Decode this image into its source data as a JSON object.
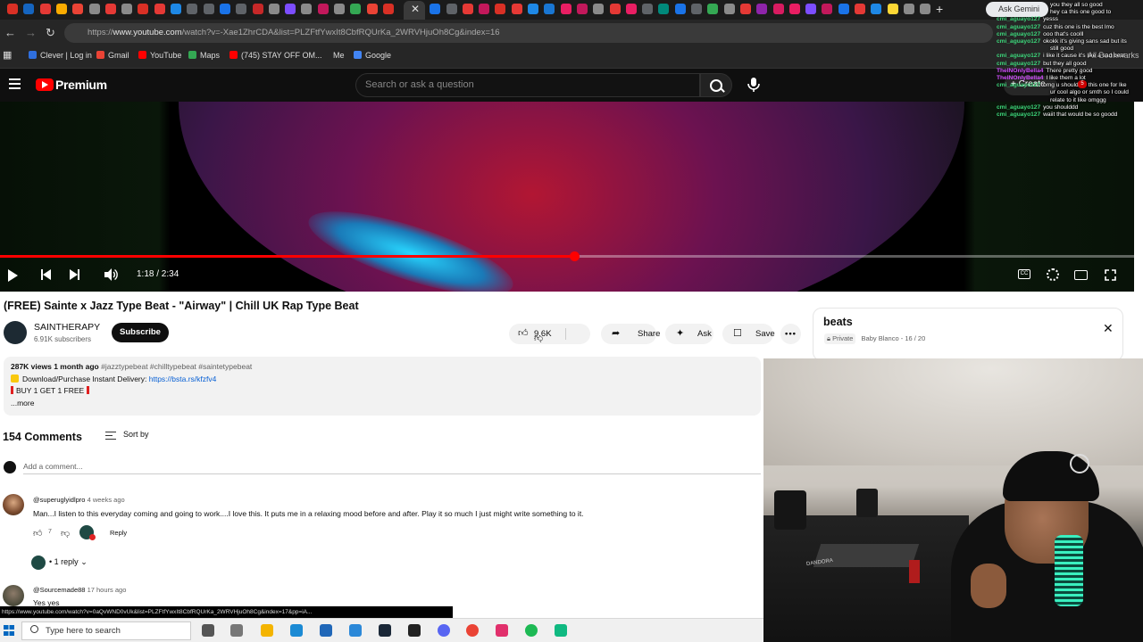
{
  "browser": {
    "tab_colors": [
      "#d93025",
      "#1565c0",
      "#e53935",
      "#f9ab00",
      "#ea4335",
      "#8a8a8a",
      "#e53935",
      "#8a8a8a",
      "#d93025",
      "#e53935",
      "#1e88e5",
      "#5f6368",
      "#5f6368",
      "#1a73e8",
      "#5f6368",
      "#c62828",
      "#8a8a8a",
      "#7c4dff",
      "#8a8a8a",
      "#c2185b",
      "#8a8a8a",
      "#34a853",
      "#ea4335",
      "#d93025",
      "#1a73e8",
      "#5f6368",
      "#e53935",
      "#c2185b",
      "#d93025",
      "#e53935",
      "#1e88e5",
      "#1976d2",
      "#e91e63",
      "#c2185b",
      "#8a8a8a",
      "#e53935",
      "#e91e63",
      "#5f6368",
      "#00897b",
      "#1a73e8",
      "#5f6368",
      "#34a853",
      "#8a8a8a",
      "#e53935",
      "#8e24aa",
      "#d81b60",
      "#e91e63",
      "#7c4dff",
      "#c2185b",
      "#1a73e8",
      "#e53935",
      "#1e88e5",
      "#fdd835",
      "#8a8a8a",
      "#8a8a8a",
      "#7c4dff",
      "#8a8a8a"
    ],
    "active_tab_close": "✕",
    "new_tab": "+",
    "ask_gemini": "Ask Gemini",
    "url_prefix": "https://",
    "url_domain": "www.youtube.com",
    "url_rest": "/watch?v=-Xae1ZhrCDA&list=PLZFtfYwxIt8CbfRQUrKa_2WRVHjuOh8Cg&index=16",
    "bookmarks": [
      {
        "label": "Clever | Log in",
        "color": "#2f6fde"
      },
      {
        "label": "Gmail",
        "color": "#ea4335"
      },
      {
        "label": "YouTube",
        "color": "#ff0000"
      },
      {
        "label": "Maps",
        "color": "#34a853"
      },
      {
        "label": "(745) STAY OFF OM...",
        "color": "#ff0000"
      },
      {
        "label": "Me",
        "color": "#262626"
      },
      {
        "label": "Google",
        "color": "#4285f4"
      }
    ],
    "all_bookmarks": "All Bookmarks"
  },
  "youtube": {
    "brand": "Premium",
    "search_placeholder": "Search or ask a question",
    "create_label": "Create",
    "notification_count": "5"
  },
  "player": {
    "time": "1:18 / 2:34",
    "progress": 0.506
  },
  "video": {
    "title": "(FREE) Sainte x Jazz Type Beat - \"Airway\" | Chill UK Rap Type Beat",
    "channel": "SAINTHERAPY",
    "subscribers": "6.91K subscribers",
    "subscribe_label": "Subscribe",
    "likes": "9.6K",
    "share_label": "Share",
    "ask_label": "Ask",
    "save_label": "Save",
    "more_label": "•••"
  },
  "description": {
    "meta": "287K views  1 month ago",
    "tags": "#jazztypebeat #chilltypebeat #saintetypebeat",
    "download_text": "Download/Purchase Instant Delivery: ",
    "download_link": "https://bsta.rs/kfzfv4",
    "promo": "BUY 1 GET 1 FREE",
    "more": "...more"
  },
  "comments": {
    "count_label": "154 Comments",
    "sort_label": "Sort by",
    "add_placeholder": "Add a comment...",
    "items": [
      {
        "handle": "@superuglyidlpro",
        "time": "4 weeks ago",
        "text": "Man...I listen to this everyday coming and going to work....I love this.  It puts me in a relaxing mood before and after.  Play it so much I just might write something to it.",
        "likes": "7",
        "reply_label": "Reply",
        "replies_label": "1 reply"
      },
      {
        "handle": "@Sourcemade88",
        "time": "17 hours ago",
        "text": "Yes yes"
      }
    ]
  },
  "playlist": {
    "title": "beats",
    "privacy": "Private",
    "owner": "Baby Blanco",
    "position": "16 / 20"
  },
  "chat": [
    {
      "user": "",
      "text": "you they all so good",
      "alt": false
    },
    {
      "user": "",
      "text": "hey ca this one good to",
      "alt": false
    },
    {
      "user": "cmi_aguayo127",
      "text": "yesss",
      "alt": false
    },
    {
      "user": "cmi_aguayo127",
      "text": "cuz this one is the best lmo",
      "alt": false
    },
    {
      "user": "cmi_aguayo127",
      "text": "ooo that's coolll",
      "alt": false
    },
    {
      "user": "cmi_aguayo127",
      "text": "okokk it's giving sans sad but its",
      "alt": false
    },
    {
      "user": "",
      "text": "still good",
      "alt": false
    },
    {
      "user": "cmi_aguayo127",
      "text": "i like it cause it's like a sad beat",
      "alt": false
    },
    {
      "user": "cmi_aguayo127",
      "text": "but they all good",
      "alt": false
    },
    {
      "user": "TheINOnlyBella4",
      "text": "There pretty good",
      "alt": true
    },
    {
      "user": "TheINOnlyBella4",
      "text": "I like them a lot",
      "alt": true
    },
    {
      "user": "cmi_aguayo127",
      "text": "omg u should do this one for lke",
      "alt": false
    },
    {
      "user": "",
      "text": "ur cool algo or smth so I could",
      "alt": false
    },
    {
      "user": "",
      "text": "relate to it like omggg",
      "alt": false
    },
    {
      "user": "cmi_aguayo127",
      "text": "you shoulddd",
      "alt": false
    },
    {
      "user": "cmi_aguayo127",
      "text": "waiit that would be so goodd",
      "alt": false
    }
  ],
  "webcam": {
    "wall_text": "DANDORA"
  },
  "status_url": "https://www.youtube.com/watch?v=0aQvWND0vUk&list=PLZFtfYwxIt8CbfRQUrKa_2WRVHjuOh8Cg&index=17&pp=iA...",
  "taskbar": {
    "search_placeholder": "Type here to search",
    "icons": [
      {
        "name": "task-view-icon",
        "color": "#555555"
      },
      {
        "name": "widgets-icon",
        "color": "#777777"
      },
      {
        "name": "file-explorer-icon",
        "color": "#f4b400"
      },
      {
        "name": "edge-icon",
        "color": "#1b8ad4"
      },
      {
        "name": "store-icon",
        "color": "#2067b8"
      },
      {
        "name": "mail-icon",
        "color": "#2b88d8"
      },
      {
        "name": "steam-icon",
        "color": "#1b2838"
      },
      {
        "name": "epic-icon",
        "color": "#222222"
      },
      {
        "name": "discord-icon",
        "color": "#5865f2"
      },
      {
        "name": "chrome-icon",
        "color": "#ea4335"
      },
      {
        "name": "instagram-icon",
        "color": "#e1306c"
      },
      {
        "name": "spotify-icon",
        "color": "#1db954"
      },
      {
        "name": "game-icon",
        "color": "#10b981"
      }
    ]
  }
}
